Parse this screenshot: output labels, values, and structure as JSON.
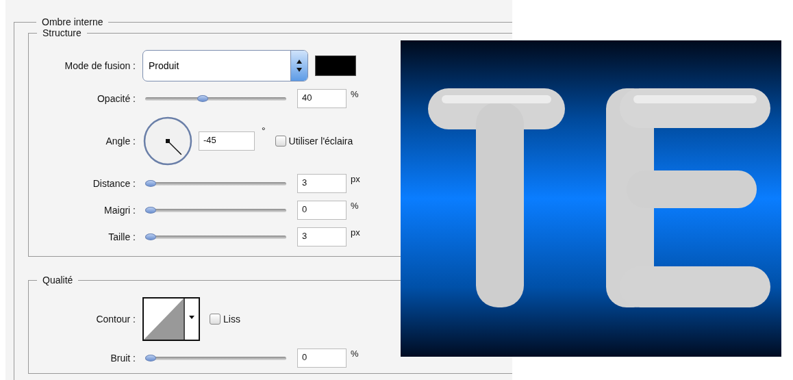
{
  "group": {
    "title": "Ombre interne",
    "structure": {
      "title": "Structure",
      "blend_mode": {
        "label": "Mode de fusion :",
        "value": "Produit",
        "color": "#000000"
      },
      "rows": [
        {
          "kind": "slider",
          "label": "Opacité :",
          "level": 0.4,
          "value": "40",
          "unit": "%"
        },
        {
          "kind": "angle",
          "label": "Angle :",
          "value": "-45",
          "unit": "°",
          "checkbox": {
            "label": "Utiliser l'éclaira",
            "checked": false
          }
        },
        {
          "kind": "slider",
          "label": "Distance :",
          "level": 0,
          "value": "3",
          "unit": "px"
        },
        {
          "kind": "slider",
          "label": "Maigri :",
          "level": 0,
          "value": "0",
          "unit": "%"
        },
        {
          "kind": "slider",
          "label": "Taille :",
          "level": 0,
          "value": "3",
          "unit": "px"
        }
      ]
    },
    "quality": {
      "title": "Qualité",
      "contour": {
        "label": "Contour :",
        "checkbox": {
          "label": "Liss",
          "checked": false
        }
      },
      "noise": {
        "label": "Bruit :",
        "level": 0,
        "value": "0",
        "unit": "%"
      }
    }
  }
}
